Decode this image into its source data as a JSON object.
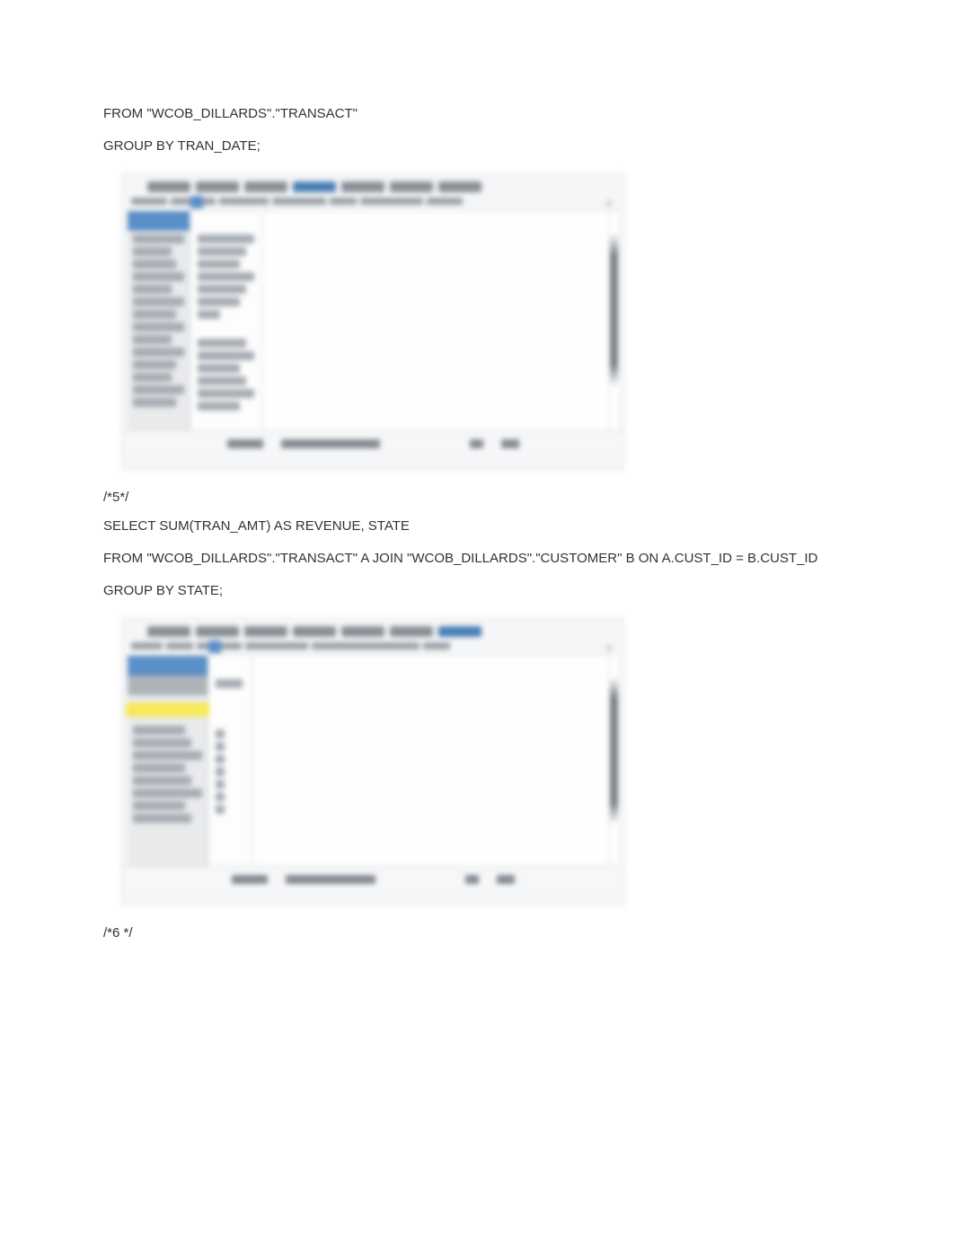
{
  "sql": {
    "block1_line1": "FROM \"WCOB_DILLARDS\".\"TRANSACT\"",
    "block1_line2": "GROUP BY TRAN_DATE;",
    "comment5": "/*5*/",
    "block2_line1": "SELECT SUM(TRAN_AMT) AS REVENUE, STATE",
    "block2_line2": "FROM \"WCOB_DILLARDS\".\"TRANSACT\" A JOIN \"WCOB_DILLARDS\".\"CUSTOMER\" B ON A.CUST_ID = B.CUST_ID",
    "block2_line3": "GROUP BY STATE;",
    "comment6": "/*6 */"
  }
}
